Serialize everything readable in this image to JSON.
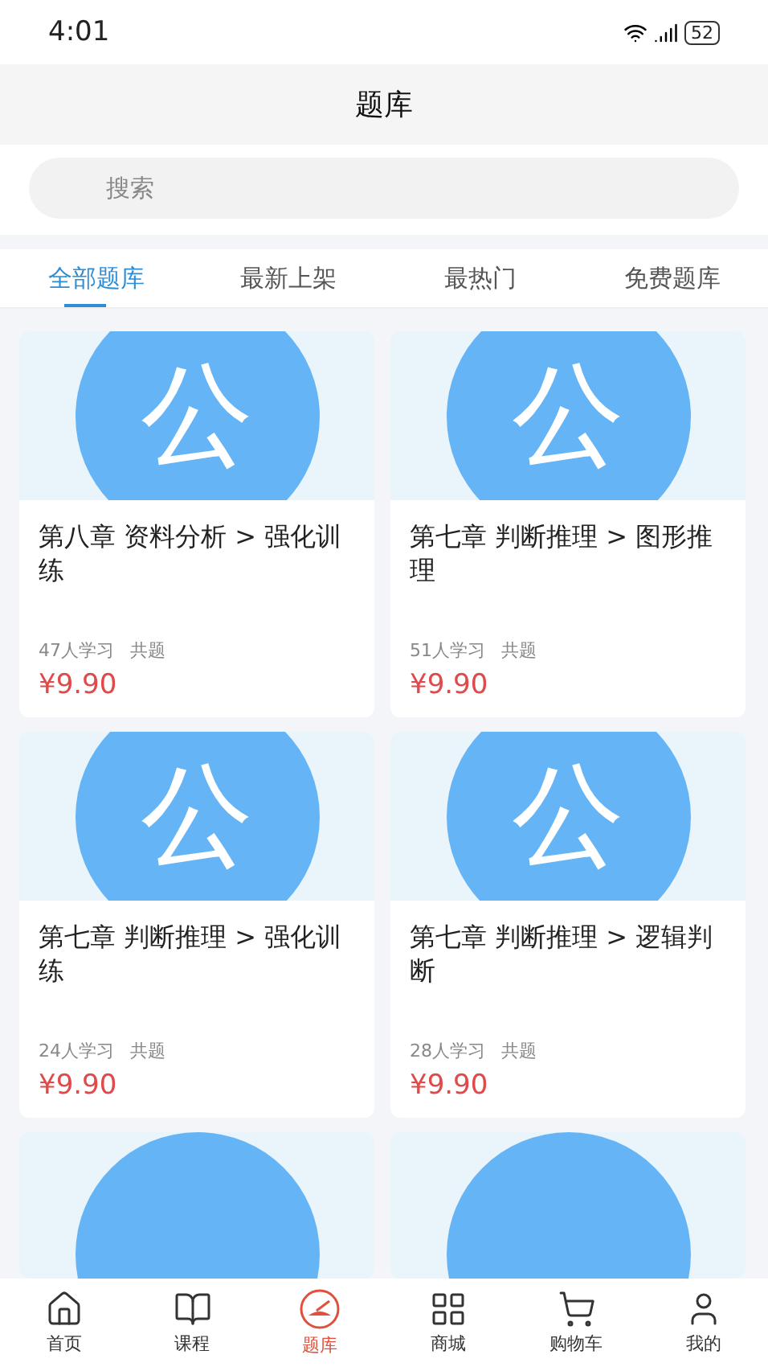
{
  "status_bar": {
    "time": "4:01",
    "battery": "52"
  },
  "header": {
    "title": "题库"
  },
  "search": {
    "placeholder": "搜索"
  },
  "tabs": [
    {
      "label": "全部题库",
      "selected": true
    },
    {
      "label": "最新上架",
      "selected": false
    },
    {
      "label": "最热门",
      "selected": false
    },
    {
      "label": "免费题库",
      "selected": false
    }
  ],
  "cards": [
    {
      "kind": "full",
      "cover_text": "公",
      "title": "第八章 资料分析 > 强化训练",
      "learners": "47人学习",
      "questions": "共题",
      "price": "¥9.90"
    },
    {
      "kind": "full",
      "cover_text": "公",
      "title": "第七章 判断推理 > 图形推理",
      "learners": "51人学习",
      "questions": "共题",
      "price": "¥9.90"
    },
    {
      "kind": "full",
      "cover_text": "公",
      "title": "第七章 判断推理 > 强化训练",
      "learners": "24人学习",
      "questions": "共题",
      "price": "¥9.90"
    },
    {
      "kind": "full",
      "cover_text": "公",
      "title": "第七章 判断推理 > 逻辑判断",
      "learners": "28人学习",
      "questions": "共题",
      "price": "¥9.90"
    },
    {
      "kind": "cover"
    },
    {
      "kind": "cover"
    }
  ],
  "bottom_nav": [
    {
      "label": "首页",
      "selected": false
    },
    {
      "label": "课程",
      "selected": false
    },
    {
      "label": "题库",
      "selected": true
    },
    {
      "label": "商城",
      "selected": false
    },
    {
      "label": "购物车",
      "selected": false
    },
    {
      "label": "我的",
      "selected": false
    }
  ]
}
